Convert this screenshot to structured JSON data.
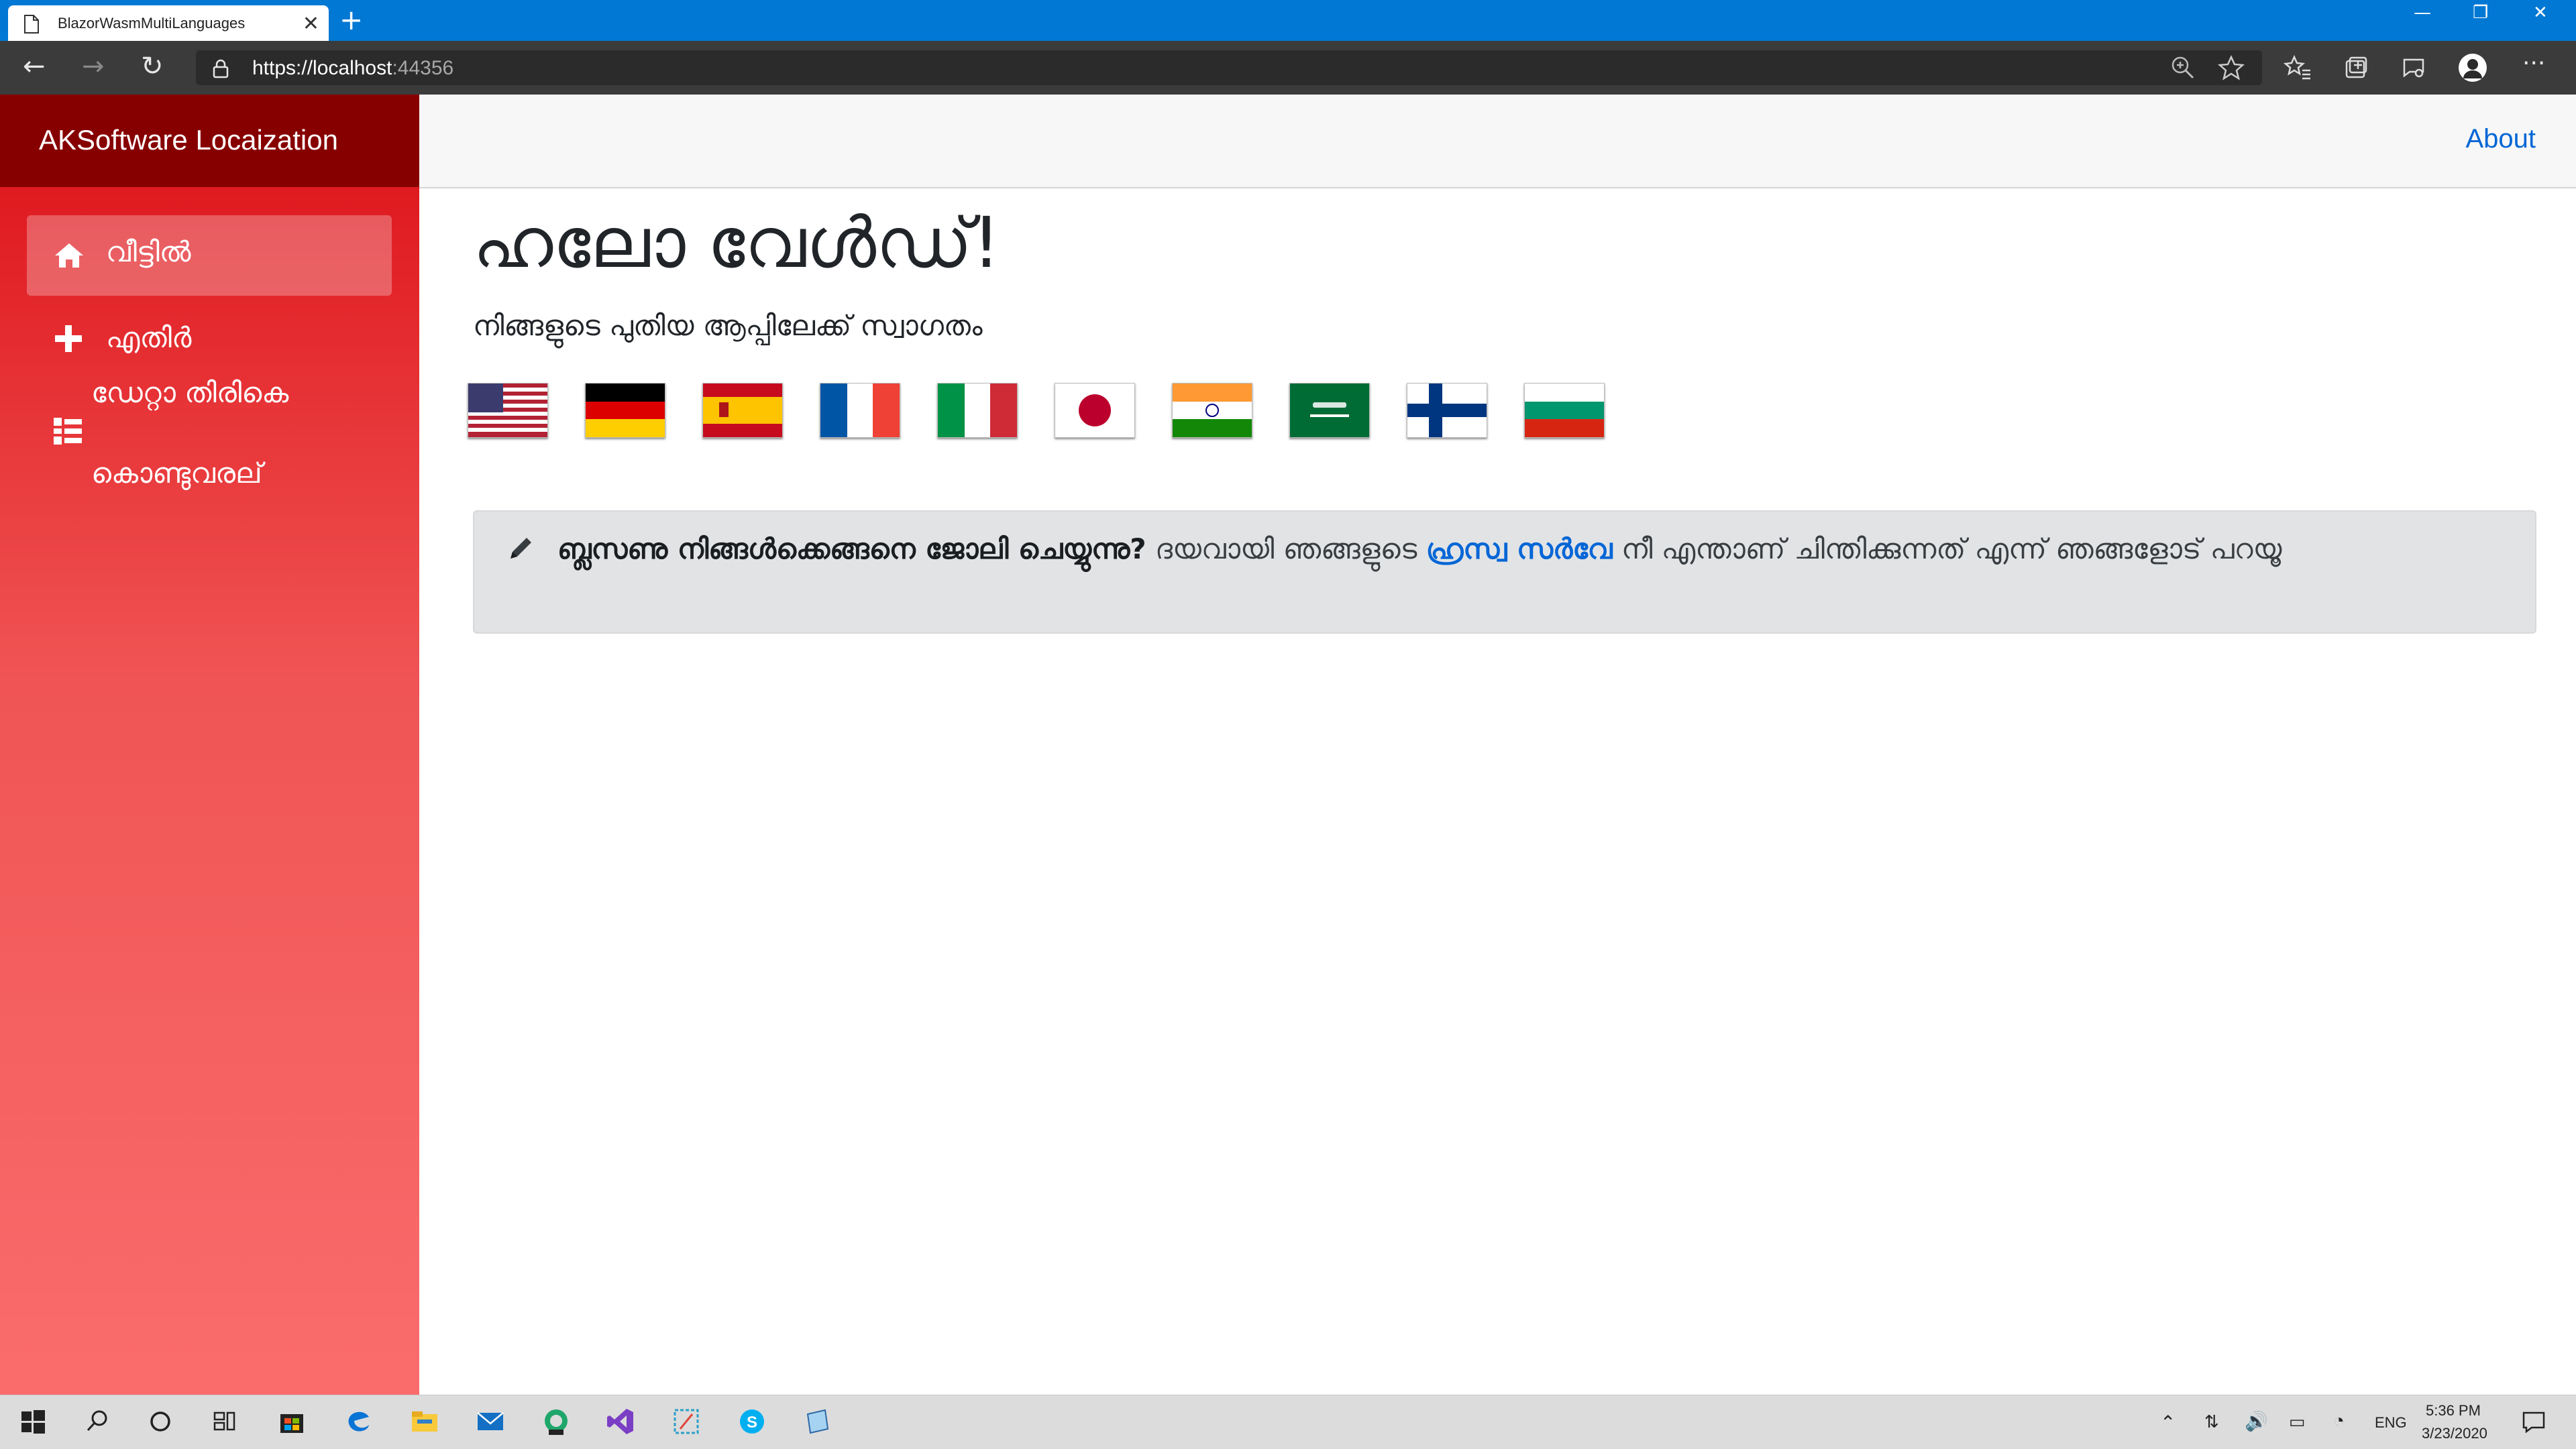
{
  "browser": {
    "tab_title": "BlazorWasmMultiLanguages",
    "url_main": "https://localhost",
    "url_port": ":44356"
  },
  "app": {
    "brand": "AKSoftware Locaization",
    "about_link": "About",
    "sidebar": {
      "items": [
        {
          "label": "വീട്ടിൽ",
          "icon": "home-icon",
          "active": true
        },
        {
          "label": "എതിർ",
          "icon": "plus-icon",
          "active": false
        },
        {
          "label": "ഡേറ്റാ തിരികെ",
          "label2": "കൊണ്ടുവരല്",
          "icon": "list-icon",
          "active": false
        }
      ]
    },
    "main": {
      "title": "ഹലോ വേൾഡ്!",
      "subtitle": "നിങ്ങളുടെ പുതിയ ആപ്പിലേക്ക് സ്വാഗതം",
      "flags": [
        "United States",
        "Germany",
        "Spain",
        "France",
        "Italy",
        "Japan",
        "India",
        "Saudi Arabia",
        "Finland",
        "Bulgaria"
      ],
      "alert": {
        "bold": "ബ്ലസണു നിങ്ങൾക്കെങ്ങനെ ജോലി ചെയ്യുന്നു?",
        "text_before": "ദയവായി ഞങ്ങളുടെ",
        "link": "ഹ്രസ്വ സർവേ",
        "text_after": "നീ എന്താണ് ചിന്തിക്കുന്നത് എന്ന് ഞങ്ങളോട് പറയൂ"
      }
    }
  },
  "taskbar": {
    "lang": "ENG",
    "time": "5:36 PM",
    "date": "3/23/2020"
  },
  "colors": {
    "titlebar": "#0078d4",
    "sidebar_top": "#dc0f16",
    "sidebar_bottom": "#fa6c6c",
    "brandbar": "#870000",
    "link": "#0366d6"
  }
}
